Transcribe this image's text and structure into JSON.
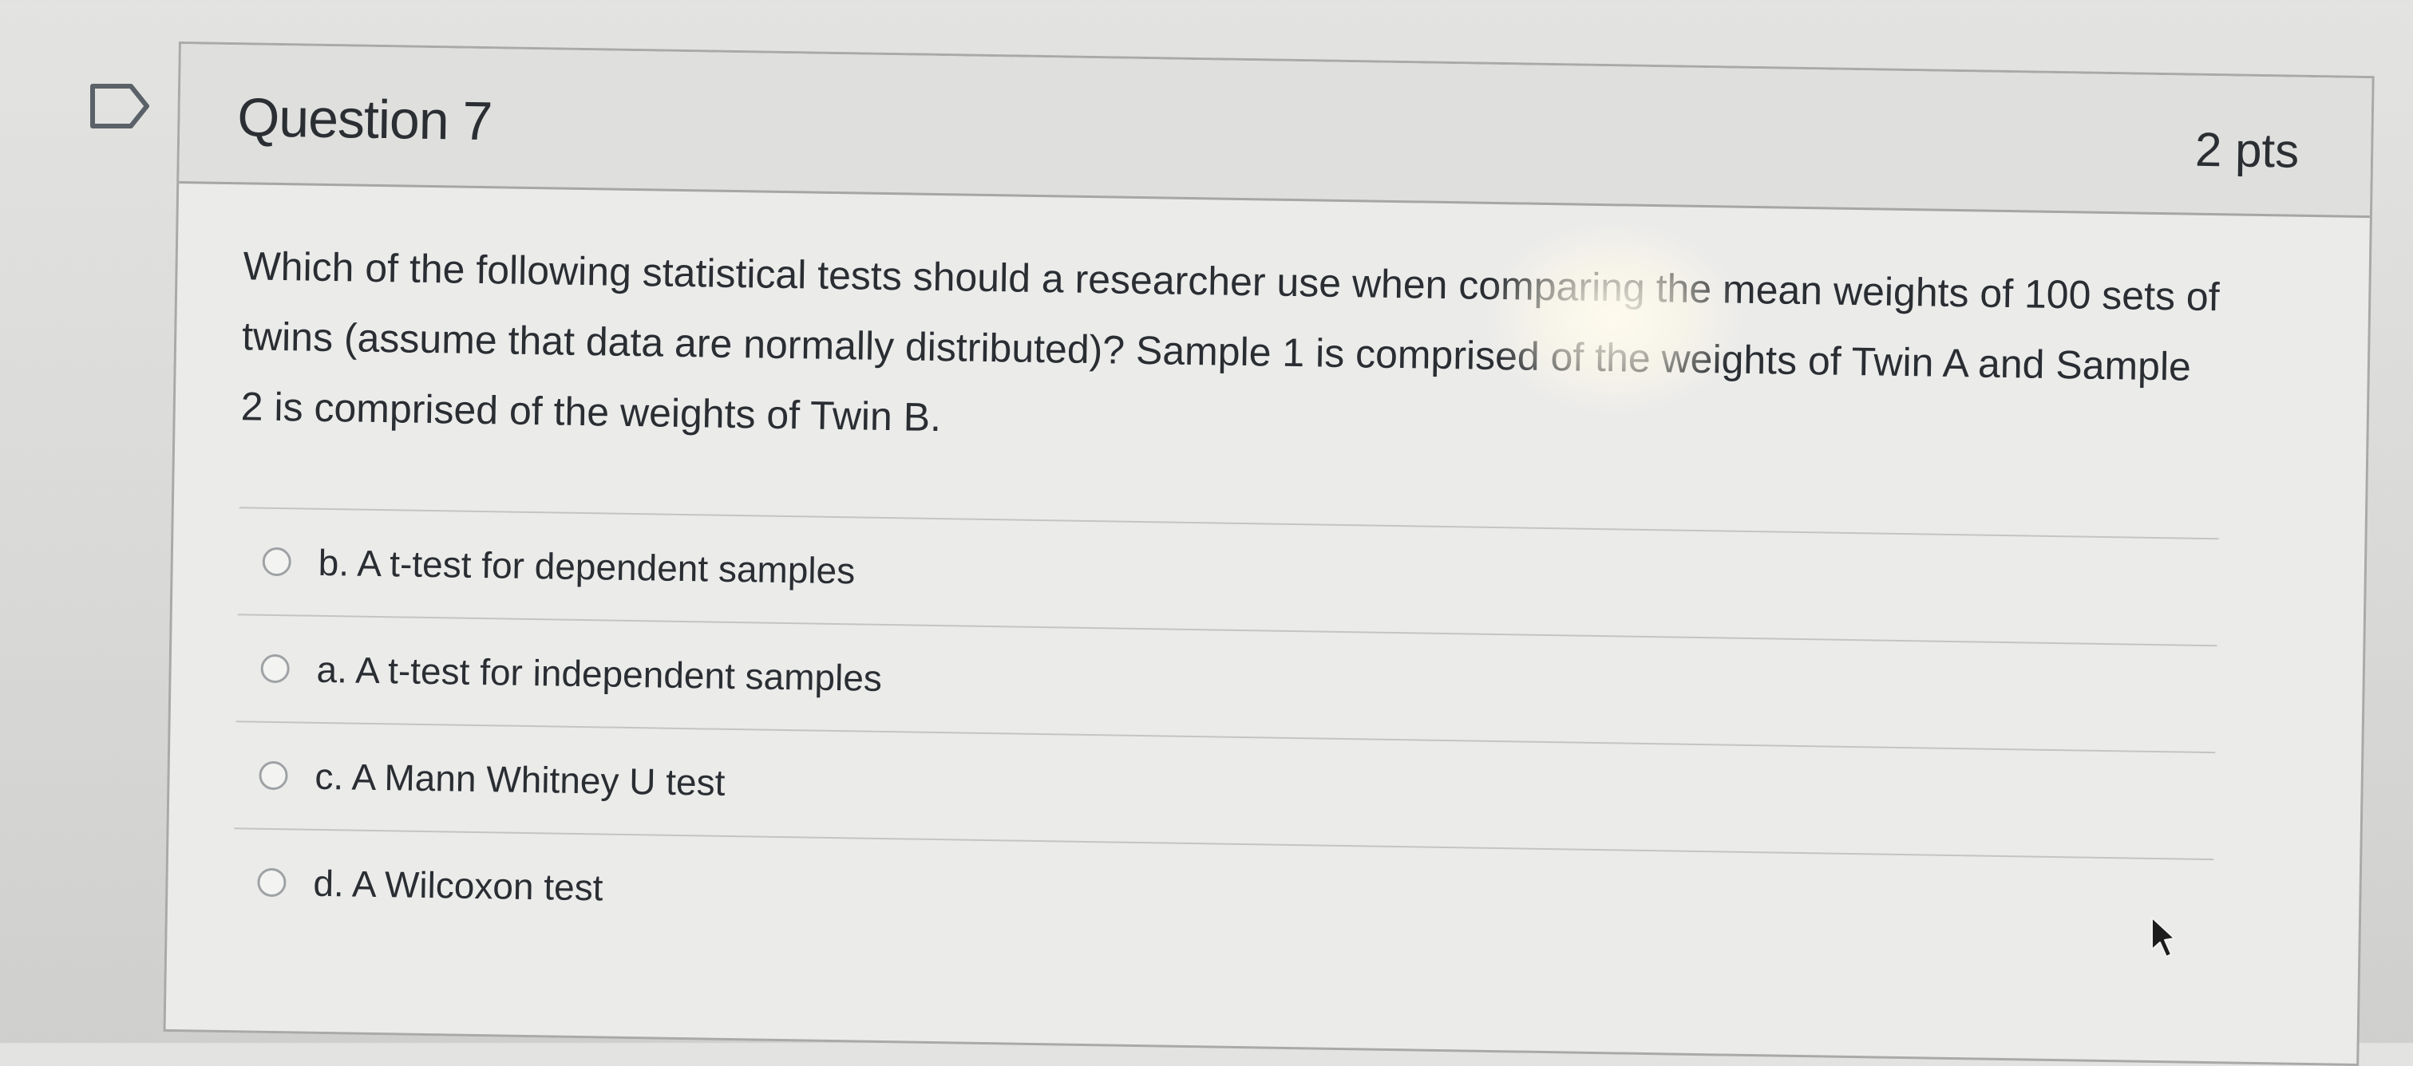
{
  "question": {
    "title": "Question 7",
    "points": "2 pts",
    "text": "Which of the following statistical tests should a researcher use when comparing the mean weights of 100 sets of twins (assume that data are normally distributed)? Sample 1 is comprised of the weights of Twin A and Sample 2 is comprised of the weights of Twin B.",
    "flag_icon": "bookmark-flag-icon"
  },
  "answers": [
    {
      "label": "b. A t-test for dependent samples"
    },
    {
      "label": "a. A t-test for independent samples"
    },
    {
      "label": "c. A Mann Whitney U test"
    },
    {
      "label": "d. A Wilcoxon test"
    }
  ],
  "colors": {
    "card_background": "#ebebea",
    "header_background": "#dfdfde",
    "border": "#a9aaa8",
    "text": "#2a2e33"
  }
}
